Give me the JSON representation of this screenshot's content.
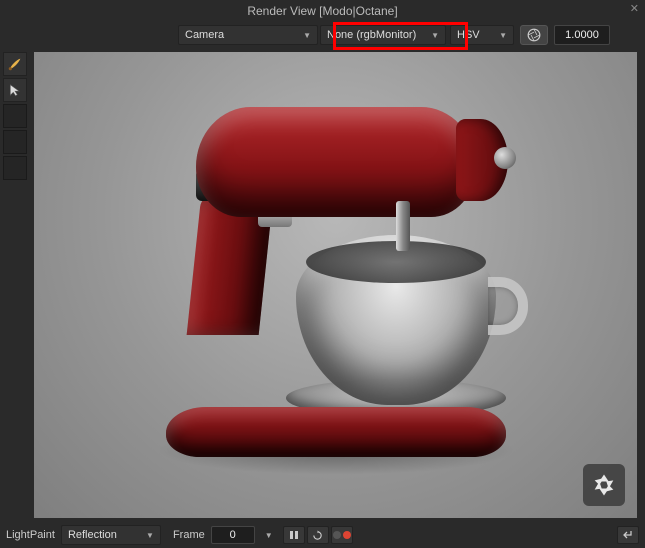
{
  "title": "Render View [Modo|Octane]",
  "topbar": {
    "camera_label": "Camera",
    "monitor_label": "None (rgbMonitor)",
    "hsv_label": "HSV",
    "exposure_value": "1.0000"
  },
  "tools": {
    "brush_icon": "brush-icon",
    "cursor_icon": "cursor-icon"
  },
  "viewport": {
    "subject": "stand-mixer-render",
    "logo": "octane-aperture-icon"
  },
  "bottombar": {
    "lightpaint_label": "LightPaint",
    "reflection_label": "Reflection",
    "frame_label": "Frame",
    "frame_value": "0"
  }
}
